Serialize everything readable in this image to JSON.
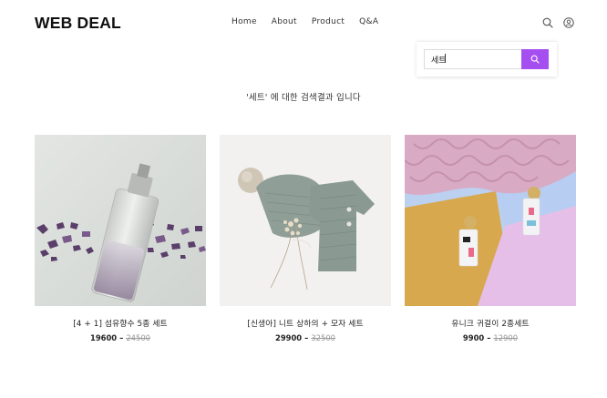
{
  "header": {
    "logo": "WEB DEAL",
    "nav": [
      "Home",
      "About",
      "Product",
      "Q&A"
    ]
  },
  "search": {
    "value": "세트"
  },
  "results": {
    "caption": "'세트' 에 대한 검색결과 입니다"
  },
  "products": [
    {
      "name": "[4 + 1] 섬유향수 5종 세트",
      "price": "19600",
      "original_price": "24500"
    },
    {
      "name": "[신생아] 니트 상하의 + 모자 세트",
      "price": "29900",
      "original_price": "32500"
    },
    {
      "name": "유니크 귀걸이 2종세트",
      "price": "9900",
      "original_price": "12900"
    }
  ],
  "colors": {
    "accent": "#a64ff0",
    "text": "#222222",
    "muted": "#999999"
  },
  "icons": {
    "search": "search-icon",
    "user": "user-icon",
    "search_button": "search-icon"
  }
}
